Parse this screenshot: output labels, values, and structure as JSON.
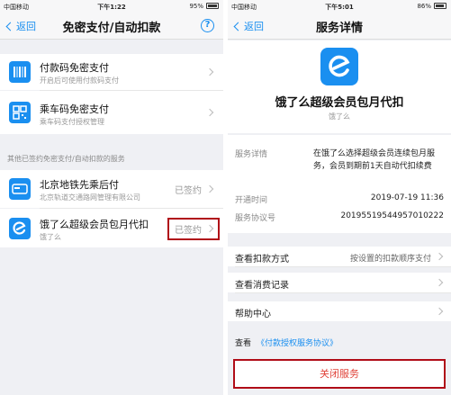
{
  "left": {
    "status": {
      "carrier": "中国移动",
      "time": "下午1:22",
      "battery": "95%"
    },
    "nav": {
      "back": "返回",
      "title": "免密支付/自动扣款",
      "help": "?"
    },
    "items": [
      {
        "title": "付款码免密支付",
        "subtitle": "开启后可使用付款码支付",
        "icon": "barcode-icon"
      },
      {
        "title": "乘车码免密支付",
        "subtitle": "乘车码支付授权管理",
        "icon": "qrcode-icon"
      }
    ],
    "section_label": "其他已签约免密支付/自动扣款的服务",
    "services": [
      {
        "title": "北京地铁先乘后付",
        "subtitle": "北京轨道交通路网管理有限公司",
        "state": "已签约",
        "icon": "subway-card-icon"
      },
      {
        "title": "饿了么超级会员包月代扣",
        "subtitle": "饿了么",
        "state": "已签约",
        "icon": "eleme-logo-icon"
      }
    ]
  },
  "right": {
    "status": {
      "carrier": "中国移动",
      "time": "下午5:01",
      "battery": "86%"
    },
    "nav": {
      "back": "返回",
      "title": "服务详情"
    },
    "header": {
      "title": "饿了么超级会员包月代扣",
      "subtitle": "饿了么",
      "icon": "eleme-logo-icon"
    },
    "details": {
      "desc_label": "服务详情",
      "desc_value": "在饿了么选择超级会员连续包月服务，会员到期前1天自动代扣续费",
      "open_label": "开通时间",
      "open_value": "2019-07-19 11:36",
      "no_label": "服务协议号",
      "no_value": "20195519544957010222"
    },
    "menu": [
      {
        "label": "查看扣款方式",
        "value": "按设置的扣款顺序支付"
      },
      {
        "label": "查看消费记录",
        "value": ""
      },
      {
        "label": "帮助中心",
        "value": ""
      }
    ],
    "agreement": {
      "prefix": "查看",
      "link": "《付款授权服务协议》"
    },
    "close_button": "关闭服务"
  },
  "colors": {
    "accent": "#1a8ff0",
    "highlight": "#b00d18",
    "danger": "#e0433a"
  }
}
